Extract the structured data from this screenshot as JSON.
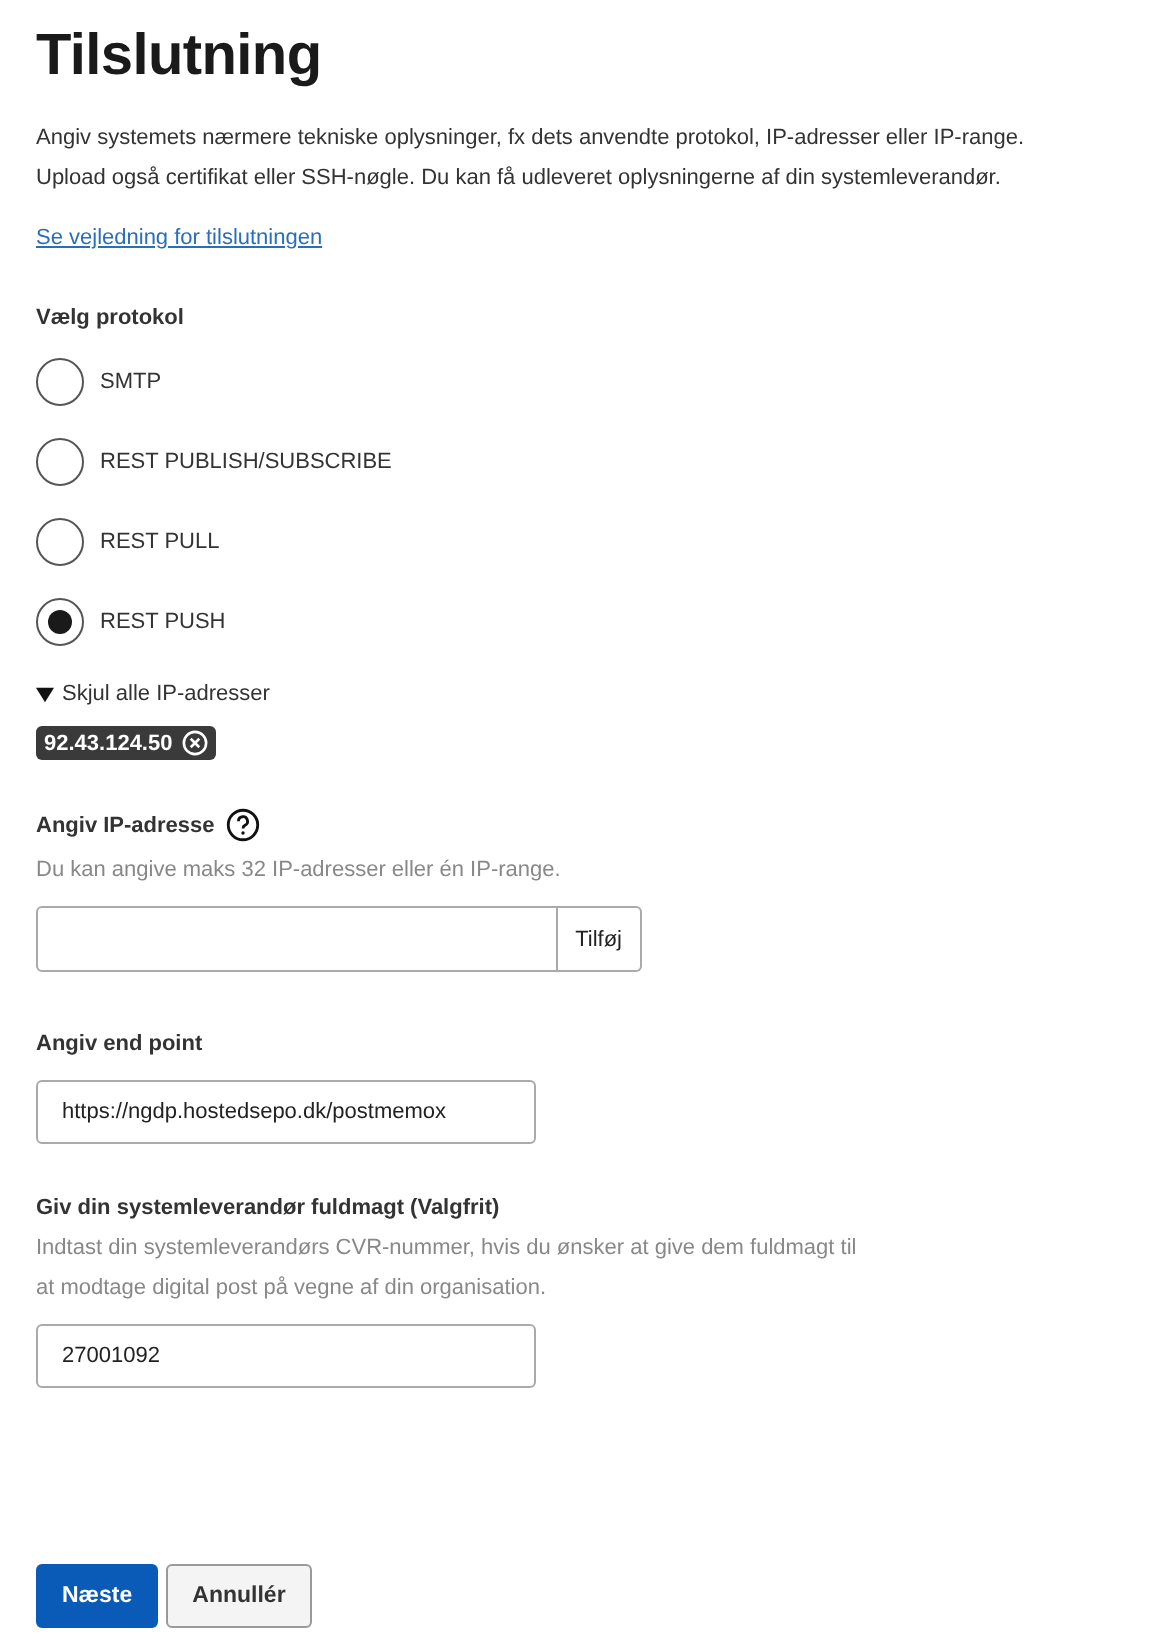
{
  "title": "Tilslutning",
  "intro": "Angiv systemets nærmere tekniske oplysninger, fx dets anvendte protokol, IP-adresser eller IP-range. Upload også certifikat eller SSH-nøgle. Du kan få udleveret oplysningerne af din systemleverandør.",
  "guide_link": "Se vejledning for tilslutningen",
  "protocol": {
    "label": "Vælg protokol",
    "options": [
      {
        "label": "SMTP",
        "selected": false
      },
      {
        "label": "REST PUBLISH/SUBSCRIBE",
        "selected": false
      },
      {
        "label": "REST PULL",
        "selected": false
      },
      {
        "label": "REST PUSH",
        "selected": true
      }
    ]
  },
  "ip_toggle": {
    "label": "Skjul alle IP-adresser",
    "expanded": true
  },
  "ip_chips": [
    "92.43.124.50"
  ],
  "ip_field": {
    "label": "Angiv IP-adresse",
    "hint": "Du kan angive maks 32 IP-adresser eller én IP-range.",
    "button": "Tilføj"
  },
  "endpoint_field": {
    "label": "Angiv end point",
    "value": "https://ngdp.hostedsepo.dk/postmemox"
  },
  "proxy_field": {
    "label": "Giv din systemleverandør fuldmagt (Valgfrit)",
    "hint": "Indtast din systemleverandørs CVR-nummer, hvis du ønsker at give dem fuldmagt til at modtage digital post på vegne af din organisation.",
    "value": "27001092"
  },
  "buttons": [
    {
      "label": "Næste",
      "kind": "primary"
    },
    {
      "label": "Annullér",
      "kind": "secondary"
    }
  ]
}
